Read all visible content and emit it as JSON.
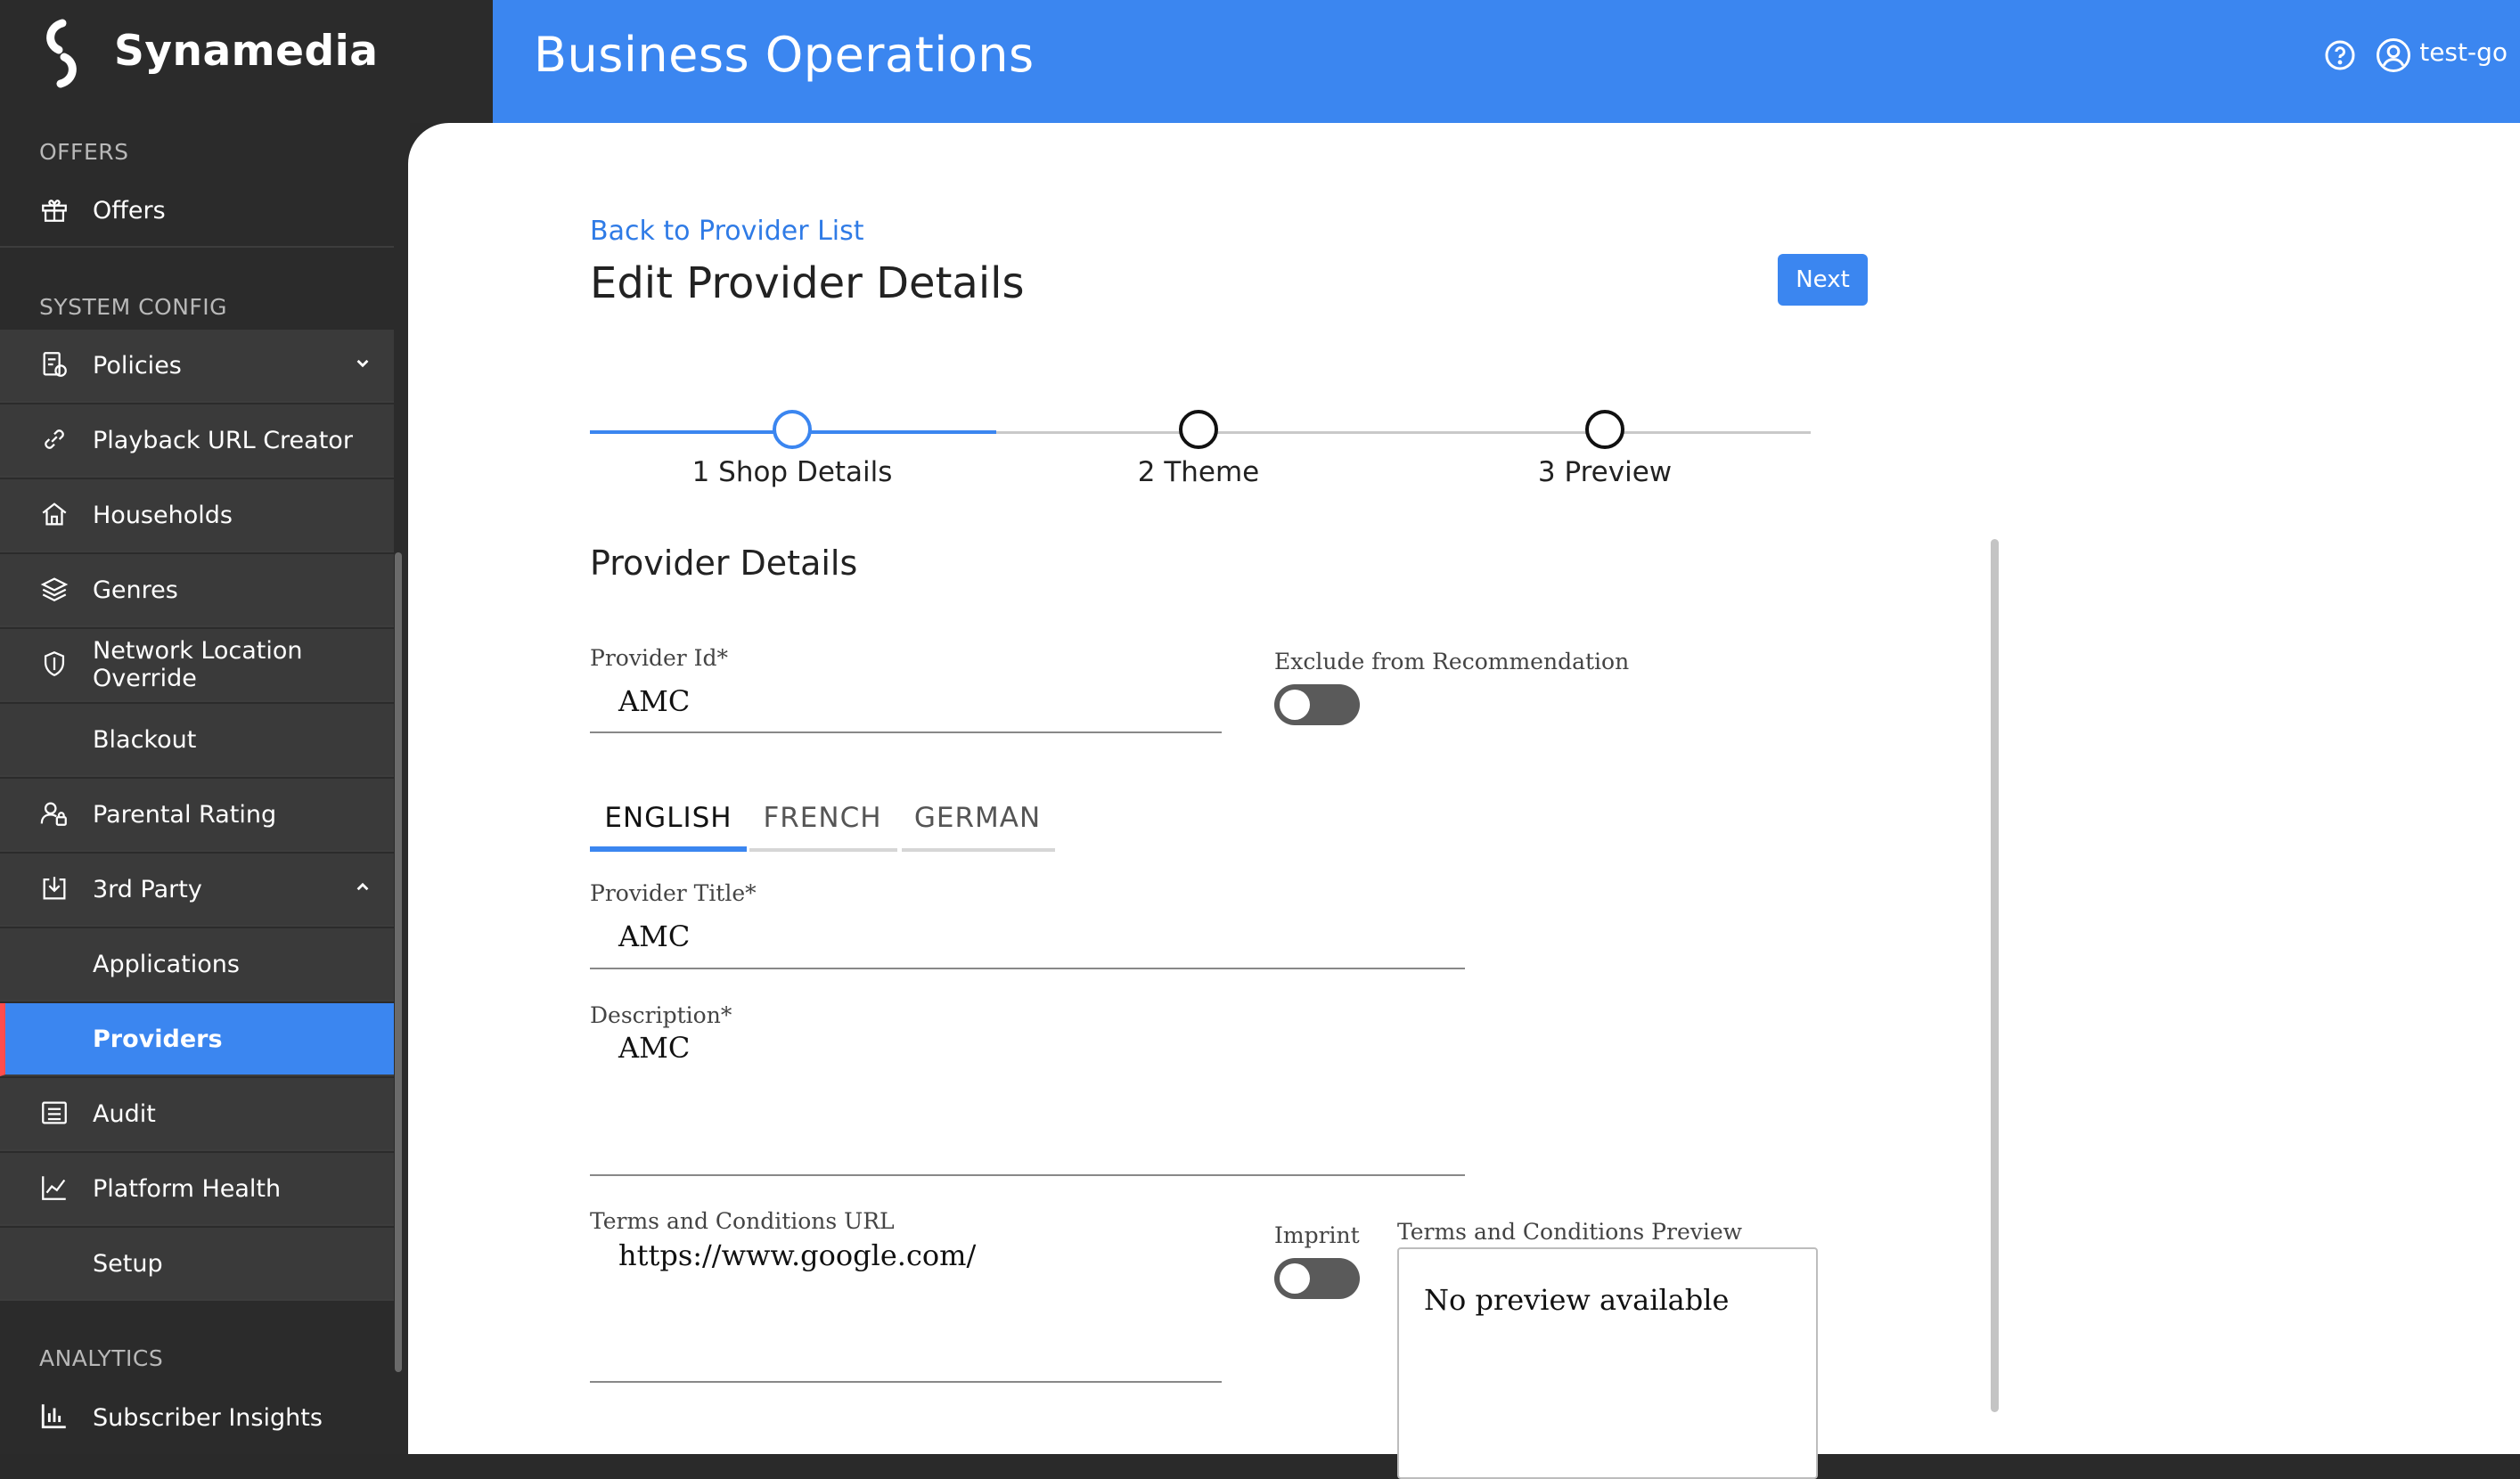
{
  "brand": {
    "name": "Synamedia"
  },
  "header": {
    "title": "Business Operations",
    "user": "test-go"
  },
  "sidebar": {
    "sections": {
      "offers": "OFFERS",
      "system_config": "SYSTEM CONFIG",
      "analytics": "ANALYTICS"
    },
    "items": {
      "offers": "Offers",
      "policies": "Policies",
      "playback_url_creator": "Playback URL Creator",
      "households": "Households",
      "genres": "Genres",
      "network_location_override": "Network Location Override",
      "blackout": "Blackout",
      "parental_rating": "Parental Rating",
      "third_party": "3rd Party",
      "applications": "Applications",
      "providers": "Providers",
      "audit": "Audit",
      "platform_health": "Platform Health",
      "setup": "Setup",
      "subscriber_insights": "Subscriber Insights"
    },
    "active_item": "Providers"
  },
  "page": {
    "back_link": "Back to Provider List",
    "title": "Edit Provider Details",
    "next_label": "Next"
  },
  "stepper": {
    "steps": [
      "1 Shop Details",
      "2 Theme",
      "3 Preview"
    ],
    "current_step": 1
  },
  "form": {
    "section_title": "Provider Details",
    "provider_id": {
      "label": "Provider Id",
      "required": "*",
      "value": "AMC"
    },
    "exclude_recommendation": {
      "label": "Exclude from Recommendation",
      "on": false
    },
    "language_tabs": [
      "ENGLISH",
      "FRENCH",
      "GERMAN"
    ],
    "active_language": "ENGLISH",
    "provider_title": {
      "label": "Provider Title",
      "required": "*",
      "value": "AMC"
    },
    "description": {
      "label": "Description",
      "required": "*",
      "value": "AMC"
    },
    "terms_url": {
      "label": "Terms and Conditions URL",
      "value": "https://www.google.com/"
    },
    "imprint": {
      "label": "Imprint",
      "on": false
    },
    "terms_preview": {
      "label": "Terms and Conditions Preview",
      "text": "No preview available"
    }
  }
}
